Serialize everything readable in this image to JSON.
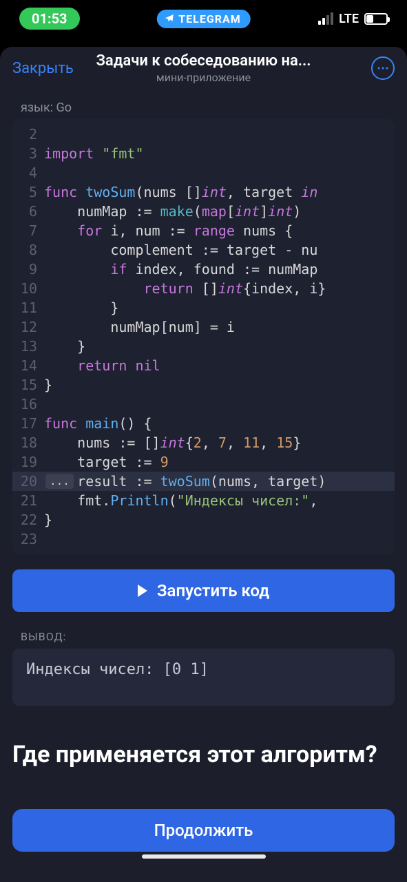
{
  "statusbar": {
    "time": "01:53",
    "app_pill": "TELEGRAM",
    "network": "LTE",
    "battery_pct": "37"
  },
  "header": {
    "close": "Закрыть",
    "title": "Задачи к собеседованию на...",
    "subtitle": "мини-приложение"
  },
  "code": {
    "lang_label": "язык: Go",
    "lines": [
      {
        "n": "2",
        "html": ""
      },
      {
        "n": "3",
        "html": "<span class='kw'>import</span> <span class='str'>\"fmt\"</span>"
      },
      {
        "n": "4",
        "html": ""
      },
      {
        "n": "5",
        "html": "<span class='kw'>func</span> <span class='fn'>twoSum</span>(nums []<span class='type'>int</span>, target <span class='type'>in</span>"
      },
      {
        "n": "6",
        "html": "    numMap <span class='op'>:=</span> <span class='builtin'>make</span>(<span class='kw'>map</span>[<span class='type'>int</span>]<span class='type'>int</span>)"
      },
      {
        "n": "7",
        "html": "    <span class='kw'>for</span> i, num <span class='op'>:=</span> <span class='kw'>range</span> nums {"
      },
      {
        "n": "8",
        "html": "        complement <span class='op'>:=</span> target <span class='op'>-</span> nu"
      },
      {
        "n": "9",
        "html": "        <span class='kw'>if</span> index, found <span class='op'>:=</span> numMap"
      },
      {
        "n": "10",
        "html": "            <span class='kw'>return</span> []<span class='type'>int</span>{index, i}"
      },
      {
        "n": "11",
        "html": "        }"
      },
      {
        "n": "12",
        "html": "        numMap[num] <span class='op'>=</span> i"
      },
      {
        "n": "13",
        "html": "    }"
      },
      {
        "n": "14",
        "html": "    <span class='kw'>return</span> <span class='kw'>nil</span>"
      },
      {
        "n": "15",
        "html": "}"
      },
      {
        "n": "16",
        "html": ""
      },
      {
        "n": "17",
        "html": "<span class='kw'>func</span> <span class='fn'>main</span>() {"
      },
      {
        "n": "18",
        "html": "    nums <span class='op'>:=</span> []<span class='type'>int</span>{<span class='num'>2</span>, <span class='num'>7</span>, <span class='num'>11</span>, <span class='num'>15</span>}"
      },
      {
        "n": "19",
        "html": "    target <span class='op'>:=</span> <span class='num'>9</span>"
      },
      {
        "n": "20",
        "html": "    result <span class='op'>:=</span> <span class='fn'>twoSum</span>(nums, target)",
        "hl": true,
        "fold": "..."
      },
      {
        "n": "21",
        "html": "    fmt.<span class='fn'>Println</span>(<span class='str'>\"Индексы чисел:\"</span>,"
      },
      {
        "n": "22",
        "html": "}"
      },
      {
        "n": "23",
        "html": ""
      }
    ]
  },
  "run_button": "Запустить код",
  "output": {
    "label": "вывод:",
    "text": "Индексы чисел: [0 1]"
  },
  "section_heading": "Где применяется этот алгоритм?",
  "continue_button": "Продолжить"
}
